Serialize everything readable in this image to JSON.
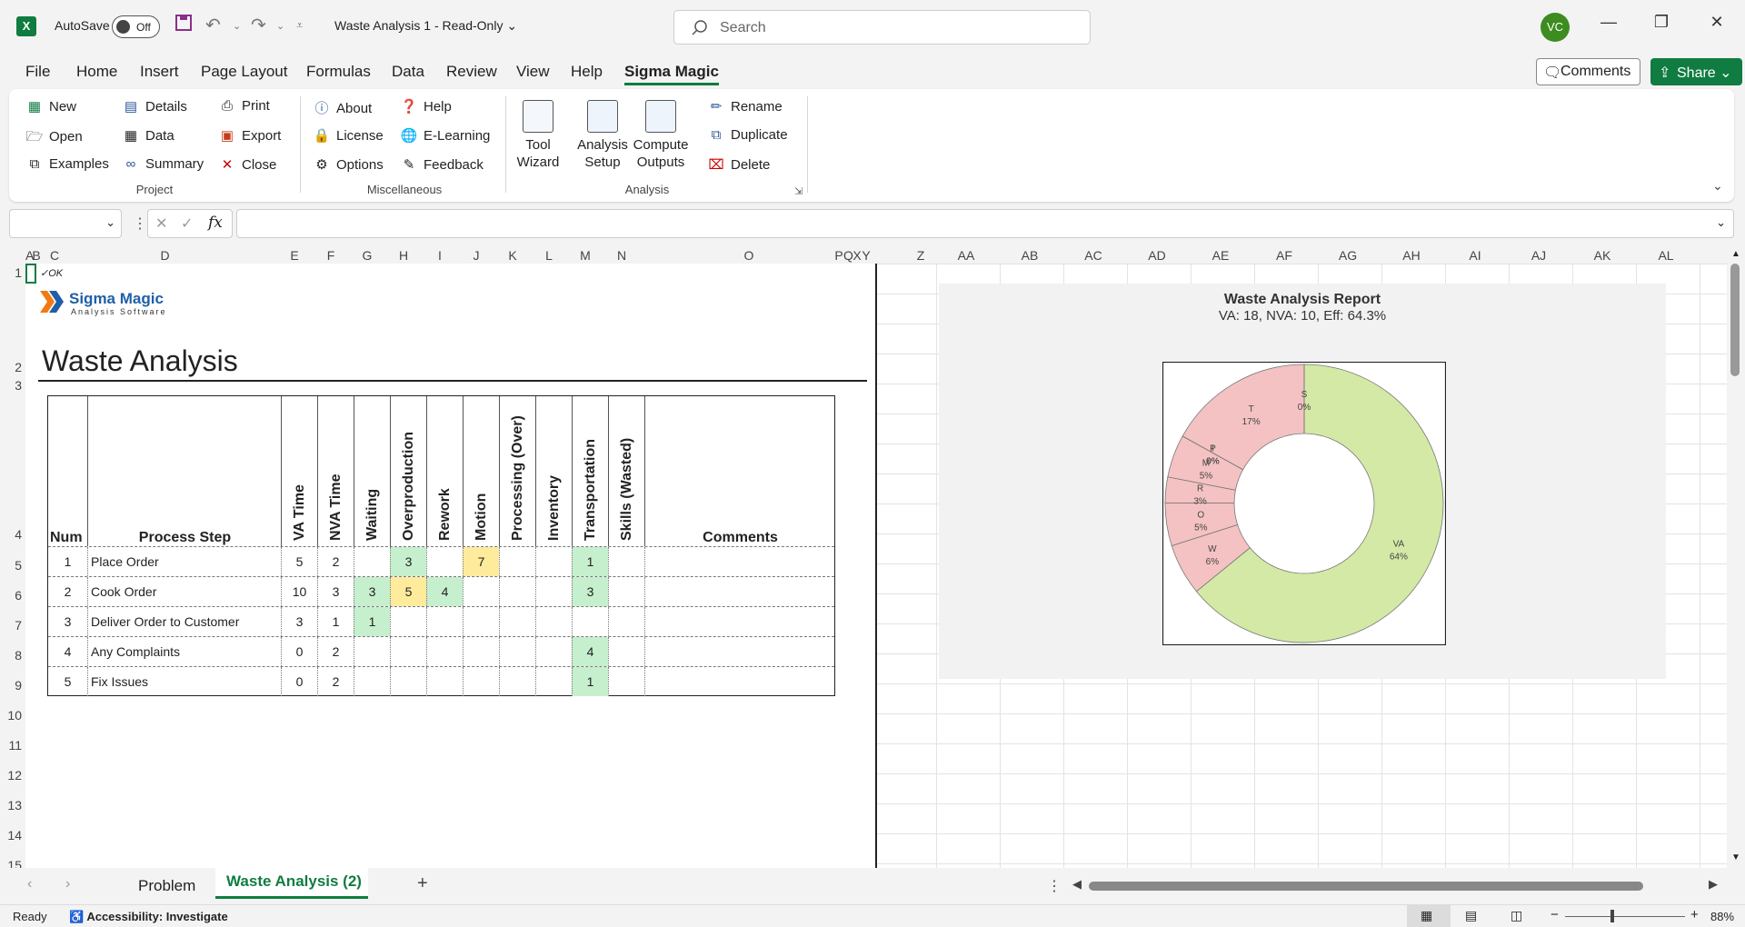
{
  "titlebar": {
    "app_icon": "X",
    "autosave_label": "AutoSave",
    "autosave_state": "Off",
    "doc_title": "Waste Analysis 1  -  Read-Only",
    "search_placeholder": "Search",
    "user_initials": "VC"
  },
  "menu": [
    "File",
    "Home",
    "Insert",
    "Page Layout",
    "Formulas",
    "Data",
    "Review",
    "View",
    "Help",
    "Sigma Magic"
  ],
  "menu_active": "Sigma Magic",
  "header_buttons": {
    "comments": "Comments",
    "share": "Share"
  },
  "ribbon": {
    "project": {
      "items": [
        "New",
        "Open",
        "Examples",
        "Details",
        "Data",
        "Summary",
        "Print",
        "Export",
        "Close"
      ],
      "label": "Project"
    },
    "misc": {
      "items": [
        "About",
        "License",
        "Options",
        "Help",
        "E-Learning",
        "Feedback"
      ],
      "label": "Miscellaneous"
    },
    "analysis": {
      "big": [
        "Tool\nWizard",
        "Analysis\nSetup",
        "Compute\nOutputs"
      ],
      "items": [
        "Rename",
        "Duplicate",
        "Delete"
      ],
      "label": "Analysis"
    }
  },
  "formula": {
    "fx": "fx"
  },
  "columns": [
    "A",
    "B",
    "C",
    "D",
    "E",
    "F",
    "G",
    "H",
    "I",
    "J",
    "K",
    "L",
    "M",
    "N",
    "O",
    "P",
    "Q",
    "X",
    "Y",
    "Z",
    "AA",
    "AB",
    "AC",
    "AD",
    "AE",
    "AF",
    "AG",
    "AH",
    "AI",
    "AJ",
    "AK",
    "AL"
  ],
  "rows": [
    "1",
    "2",
    "3",
    "4",
    "5",
    "6",
    "7",
    "8",
    "9",
    "10",
    "11",
    "12",
    "13",
    "14",
    "15"
  ],
  "sheet": {
    "ok_mark": "✓OK",
    "logo_name": "Sigma Magic",
    "logo_sub": "Analysis Software",
    "title": "Waste Analysis",
    "headers": {
      "num": "Num",
      "step": "Process Step",
      "comments": "Comments",
      "vertical": [
        "VA Time",
        "NVA Time",
        "Waiting",
        "Overproduction",
        "Rework",
        "Motion",
        "Processing (Over)",
        "Inventory",
        "Transportation",
        "Skills (Wasted)"
      ]
    },
    "table_rows": [
      {
        "num": "1",
        "step": "Place Order",
        "va": "5",
        "nva": "2",
        "waiting": "",
        "over": "3",
        "rework": "",
        "motion": "7",
        "proc": "",
        "inv": "",
        "transp": "1",
        "skills": ""
      },
      {
        "num": "2",
        "step": "Cook Order",
        "va": "10",
        "nva": "3",
        "waiting": "3",
        "over": "5",
        "rework": "4",
        "motion": "",
        "proc": "",
        "inv": "",
        "transp": "3",
        "skills": ""
      },
      {
        "num": "3",
        "step": "Deliver Order to Customer",
        "va": "3",
        "nva": "1",
        "waiting": "1",
        "over": "",
        "rework": "",
        "motion": "",
        "proc": "",
        "inv": "",
        "transp": "",
        "skills": ""
      },
      {
        "num": "4",
        "step": "Any Complaints",
        "va": "0",
        "nva": "2",
        "waiting": "",
        "over": "",
        "rework": "",
        "motion": "",
        "proc": "",
        "inv": "",
        "transp": "4",
        "skills": ""
      },
      {
        "num": "5",
        "step": "Fix Issues",
        "va": "0",
        "nva": "2",
        "waiting": "",
        "over": "",
        "rework": "",
        "motion": "",
        "proc": "",
        "inv": "",
        "transp": "1",
        "skills": ""
      }
    ]
  },
  "chart_data": {
    "type": "pie",
    "title": "Waste Analysis Report",
    "subtitle": "VA: 18, NVA: 10, Eff: 64.3%",
    "donut": true,
    "slices": [
      {
        "label": "VA",
        "pct": "64%",
        "value": 64.3,
        "color": "#d4e9a6"
      },
      {
        "label": "W",
        "pct": "6%",
        "value": 6,
        "color": "#f4c2c2"
      },
      {
        "label": "O",
        "pct": "5%",
        "value": 5,
        "color": "#f4c2c2"
      },
      {
        "label": "R",
        "pct": "3%",
        "value": 3,
        "color": "#f4c2c2"
      },
      {
        "label": "M",
        "pct": "5%",
        "value": 5,
        "color": "#f4c2c2"
      },
      {
        "label": "P",
        "pct": "0%",
        "value": 0,
        "color": "#f4c2c2"
      },
      {
        "label": "I",
        "pct": "0%",
        "value": 0,
        "color": "#f4c2c2"
      },
      {
        "label": "T",
        "pct": "17%",
        "value": 17,
        "color": "#f4c2c2"
      },
      {
        "label": "S",
        "pct": "0%",
        "value": 0,
        "color": "#f4c2c2"
      }
    ]
  },
  "tabs": [
    "Problem",
    "Waste Analysis (2)"
  ],
  "active_tab": "Waste Analysis (2)",
  "status": {
    "ready": "Ready",
    "accessibility": "Accessibility: Investigate",
    "zoom": "88%"
  },
  "colors": {
    "excel_green": "#107c41",
    "va_green": "#d4e9a6",
    "nva_red": "#f4c2c2",
    "cell_green": "#c6efce",
    "cell_yellow": "#ffeb9c"
  }
}
